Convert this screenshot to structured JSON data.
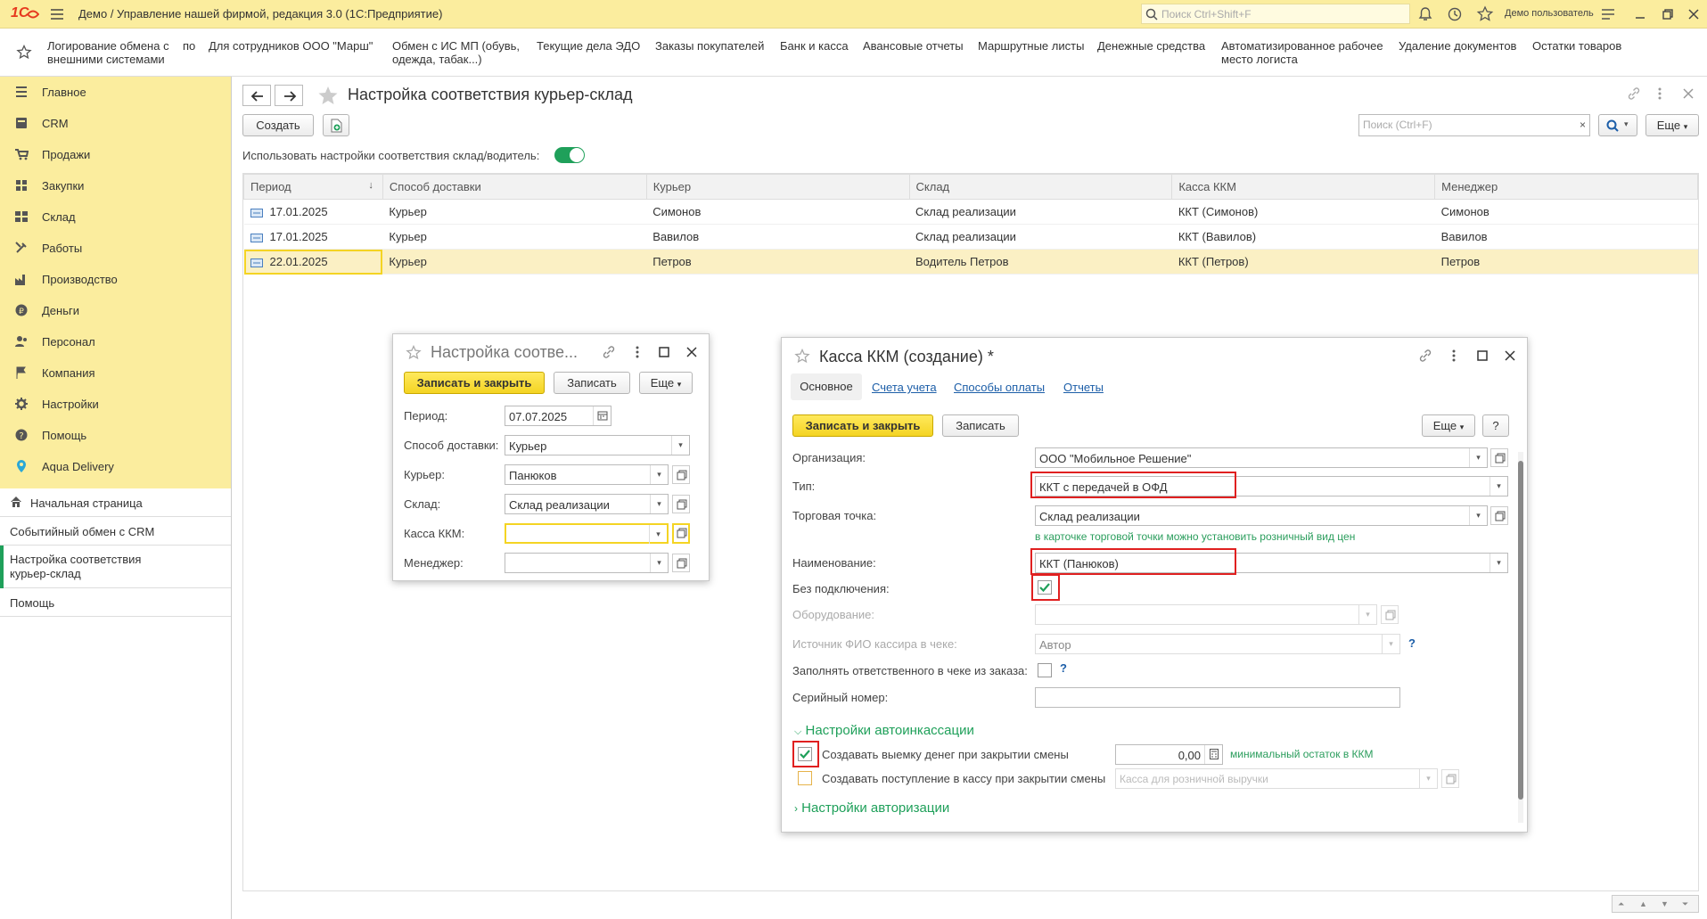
{
  "titlebar": {
    "logo": "1С",
    "title": "Демо / Управление нашей фирмой, редакция 3.0  (1С:Предприятие)",
    "search_placeholder": "Поиск Ctrl+Shift+F",
    "user": "Демо пользователь"
  },
  "sections": [
    "Логирование обмена с внешними системами",
    "по",
    "Для сотрудников ООО \"Марш\"",
    "Обмен с ИС МП (обувь, одежда, табак...)",
    "Текущие дела ЭДО",
    "Заказы покупателей",
    "Банк и касса",
    "Авансовые отчеты",
    "Маршрутные листы",
    "Денежные средства",
    "Автоматизированное рабочее место логиста",
    "Удаление документов",
    "Остатки товаров"
  ],
  "nav": [
    "Главное",
    "CRM",
    "Продажи",
    "Закупки",
    "Склад",
    "Работы",
    "Производство",
    "Деньги",
    "Персонал",
    "Компания",
    "Настройки",
    "Помощь",
    "Aqua Delivery"
  ],
  "open_windows": [
    "Начальная страница",
    "Событийный обмен с CRM",
    "Настройка соответствия курьер-склад",
    "Помощь"
  ],
  "main": {
    "title": "Настройка соответствия курьер-склад",
    "create": "Создать",
    "search_placeholder": "Поиск (Ctrl+F)",
    "more": "Еще",
    "toggle_label": "Использовать настройки соответствия склад/водитель:",
    "columns": [
      "Период",
      "Способ доставки",
      "Курьер",
      "Склад",
      "Касса ККМ",
      "Менеджер"
    ],
    "rows": [
      [
        "17.01.2025",
        "Курьер",
        "Симонов",
        "Склад реализации",
        "ККТ (Симонов)",
        "Симонов"
      ],
      [
        "17.01.2025",
        "Курьер",
        "Вавилов",
        "Склад реализации",
        "ККТ (Вавилов)",
        "Вавилов"
      ],
      [
        "22.01.2025",
        "Курьер",
        "Петров",
        "Водитель Петров",
        "ККТ (Петров)",
        "Петров"
      ]
    ]
  },
  "dialog1": {
    "title": "Настройка соотве...",
    "save_close": "Записать и закрыть",
    "save": "Записать",
    "more": "Еще",
    "period_label": "Период:",
    "period": "07.07.2025",
    "delivery_label": "Способ доставки:",
    "delivery": "Курьер",
    "courier_label": "Курьер:",
    "courier": "Панюков",
    "warehouse_label": "Склад:",
    "warehouse": "Склад реализации",
    "kkm_label": "Касса ККМ:",
    "kkm": "",
    "manager_label": "Менеджер:",
    "manager": ""
  },
  "dialog2": {
    "title": "Касса ККМ (создание) *",
    "tabs": [
      "Основное",
      "Счета учета",
      "Способы оплаты",
      "Отчеты"
    ],
    "save_close": "Записать и закрыть",
    "save": "Записать",
    "more": "Еще",
    "help": "?",
    "org_label": "Организация:",
    "org": "ООО \"Мобильное Решение\"",
    "type_label": "Тип:",
    "type": "ККТ с передачей в ОФД",
    "point_label": "Торговая точка:",
    "point": "Склад реализации",
    "point_hint": "в карточке торговой точки можно установить розничный вид цен",
    "name_label": "Наименование:",
    "name": "ККТ (Панюков)",
    "offline_label": "Без подключения:",
    "equipment_label": "Оборудование:",
    "cashier_label": "Источник ФИО кассира в чеке:",
    "cashier": "Автор",
    "fill_resp_label": "Заполнять ответственного в чеке из заказа:",
    "serial_label": "Серийный номер:",
    "auto_group": "Настройки автоинкассации",
    "withdraw_label": "Создавать выемку денег при закрытии смены",
    "withdraw_value": "0,00",
    "withdraw_hint": "минимальный остаток в ККМ",
    "receipt_label": "Создавать поступление в кассу при закрытии смены",
    "receipt_placeholder": "Касса для розничной выручки",
    "auth_group": "Настройки авторизации"
  },
  "colors": {
    "yellow": "#fbed9e",
    "accent": "#f4d423",
    "green": "#1fa05a",
    "link": "#1c5ea8",
    "red": "#e02020"
  }
}
